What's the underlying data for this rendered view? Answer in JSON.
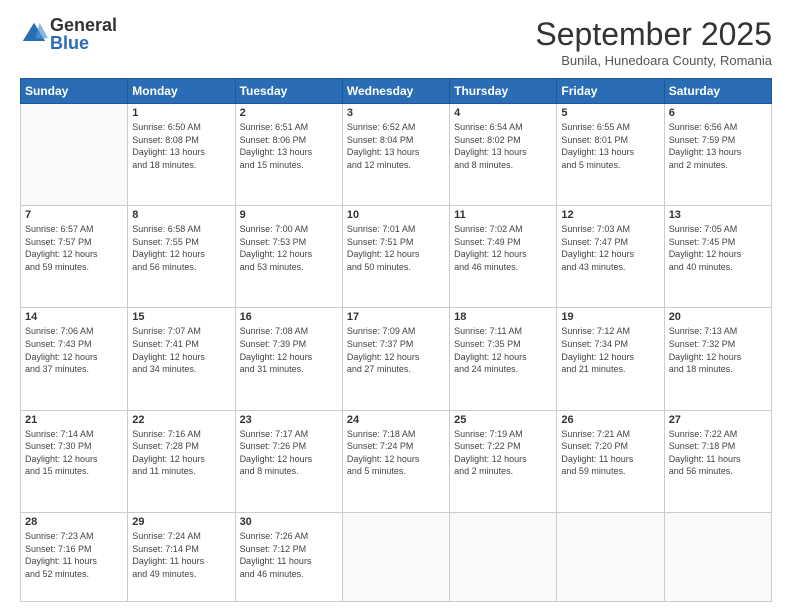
{
  "logo": {
    "general": "General",
    "blue": "Blue"
  },
  "title": "September 2025",
  "subtitle": "Bunila, Hunedoara County, Romania",
  "days_of_week": [
    "Sunday",
    "Monday",
    "Tuesday",
    "Wednesday",
    "Thursday",
    "Friday",
    "Saturday"
  ],
  "weeks": [
    [
      {
        "day": "",
        "info": ""
      },
      {
        "day": "1",
        "info": "Sunrise: 6:50 AM\nSunset: 8:08 PM\nDaylight: 13 hours\nand 18 minutes."
      },
      {
        "day": "2",
        "info": "Sunrise: 6:51 AM\nSunset: 8:06 PM\nDaylight: 13 hours\nand 15 minutes."
      },
      {
        "day": "3",
        "info": "Sunrise: 6:52 AM\nSunset: 8:04 PM\nDaylight: 13 hours\nand 12 minutes."
      },
      {
        "day": "4",
        "info": "Sunrise: 6:54 AM\nSunset: 8:02 PM\nDaylight: 13 hours\nand 8 minutes."
      },
      {
        "day": "5",
        "info": "Sunrise: 6:55 AM\nSunset: 8:01 PM\nDaylight: 13 hours\nand 5 minutes."
      },
      {
        "day": "6",
        "info": "Sunrise: 6:56 AM\nSunset: 7:59 PM\nDaylight: 13 hours\nand 2 minutes."
      }
    ],
    [
      {
        "day": "7",
        "info": "Sunrise: 6:57 AM\nSunset: 7:57 PM\nDaylight: 12 hours\nand 59 minutes."
      },
      {
        "day": "8",
        "info": "Sunrise: 6:58 AM\nSunset: 7:55 PM\nDaylight: 12 hours\nand 56 minutes."
      },
      {
        "day": "9",
        "info": "Sunrise: 7:00 AM\nSunset: 7:53 PM\nDaylight: 12 hours\nand 53 minutes."
      },
      {
        "day": "10",
        "info": "Sunrise: 7:01 AM\nSunset: 7:51 PM\nDaylight: 12 hours\nand 50 minutes."
      },
      {
        "day": "11",
        "info": "Sunrise: 7:02 AM\nSunset: 7:49 PM\nDaylight: 12 hours\nand 46 minutes."
      },
      {
        "day": "12",
        "info": "Sunrise: 7:03 AM\nSunset: 7:47 PM\nDaylight: 12 hours\nand 43 minutes."
      },
      {
        "day": "13",
        "info": "Sunrise: 7:05 AM\nSunset: 7:45 PM\nDaylight: 12 hours\nand 40 minutes."
      }
    ],
    [
      {
        "day": "14",
        "info": "Sunrise: 7:06 AM\nSunset: 7:43 PM\nDaylight: 12 hours\nand 37 minutes."
      },
      {
        "day": "15",
        "info": "Sunrise: 7:07 AM\nSunset: 7:41 PM\nDaylight: 12 hours\nand 34 minutes."
      },
      {
        "day": "16",
        "info": "Sunrise: 7:08 AM\nSunset: 7:39 PM\nDaylight: 12 hours\nand 31 minutes."
      },
      {
        "day": "17",
        "info": "Sunrise: 7:09 AM\nSunset: 7:37 PM\nDaylight: 12 hours\nand 27 minutes."
      },
      {
        "day": "18",
        "info": "Sunrise: 7:11 AM\nSunset: 7:35 PM\nDaylight: 12 hours\nand 24 minutes."
      },
      {
        "day": "19",
        "info": "Sunrise: 7:12 AM\nSunset: 7:34 PM\nDaylight: 12 hours\nand 21 minutes."
      },
      {
        "day": "20",
        "info": "Sunrise: 7:13 AM\nSunset: 7:32 PM\nDaylight: 12 hours\nand 18 minutes."
      }
    ],
    [
      {
        "day": "21",
        "info": "Sunrise: 7:14 AM\nSunset: 7:30 PM\nDaylight: 12 hours\nand 15 minutes."
      },
      {
        "day": "22",
        "info": "Sunrise: 7:16 AM\nSunset: 7:28 PM\nDaylight: 12 hours\nand 11 minutes."
      },
      {
        "day": "23",
        "info": "Sunrise: 7:17 AM\nSunset: 7:26 PM\nDaylight: 12 hours\nand 8 minutes."
      },
      {
        "day": "24",
        "info": "Sunrise: 7:18 AM\nSunset: 7:24 PM\nDaylight: 12 hours\nand 5 minutes."
      },
      {
        "day": "25",
        "info": "Sunrise: 7:19 AM\nSunset: 7:22 PM\nDaylight: 12 hours\nand 2 minutes."
      },
      {
        "day": "26",
        "info": "Sunrise: 7:21 AM\nSunset: 7:20 PM\nDaylight: 11 hours\nand 59 minutes."
      },
      {
        "day": "27",
        "info": "Sunrise: 7:22 AM\nSunset: 7:18 PM\nDaylight: 11 hours\nand 56 minutes."
      }
    ],
    [
      {
        "day": "28",
        "info": "Sunrise: 7:23 AM\nSunset: 7:16 PM\nDaylight: 11 hours\nand 52 minutes."
      },
      {
        "day": "29",
        "info": "Sunrise: 7:24 AM\nSunset: 7:14 PM\nDaylight: 11 hours\nand 49 minutes."
      },
      {
        "day": "30",
        "info": "Sunrise: 7:26 AM\nSunset: 7:12 PM\nDaylight: 11 hours\nand 46 minutes."
      },
      {
        "day": "",
        "info": ""
      },
      {
        "day": "",
        "info": ""
      },
      {
        "day": "",
        "info": ""
      },
      {
        "day": "",
        "info": ""
      }
    ]
  ]
}
